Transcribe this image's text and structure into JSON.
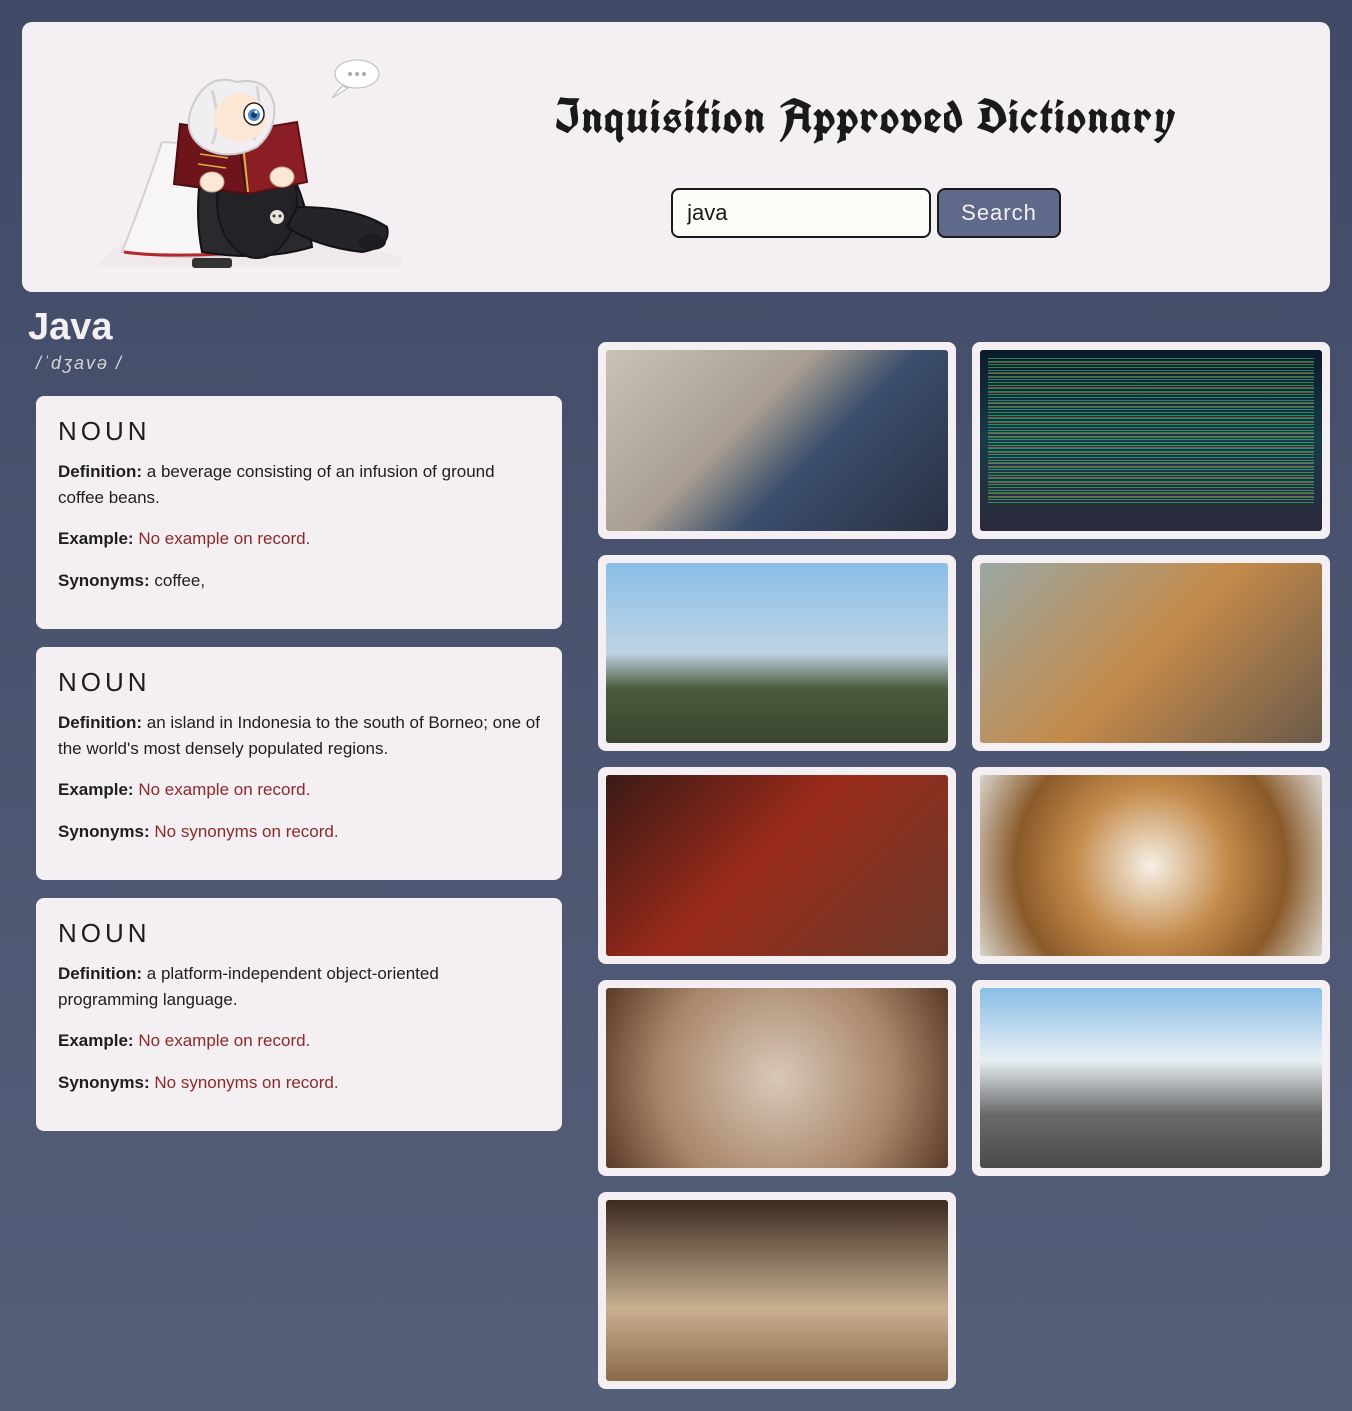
{
  "header": {
    "title": "Inquisition Approved Dictionary",
    "search_value": "java",
    "search_label": "Search"
  },
  "word": {
    "title": "Java",
    "phonetic": "/ˈdʒavə /"
  },
  "labels": {
    "definition": "Definition:",
    "example": "Example:",
    "synonyms": "Synonyms:",
    "no_example": "No example on record.",
    "no_synonyms": "No synonyms on record."
  },
  "definitions": [
    {
      "pos": "NOUN",
      "text": "a beverage consisting of an infusion of ground coffee beans.",
      "example": null,
      "synonyms": "coffee,"
    },
    {
      "pos": "NOUN",
      "text": "an island in Indonesia to the south of Borneo; one of the world's most densely populated regions.",
      "example": null,
      "synonyms": null
    },
    {
      "pos": "NOUN",
      "text": "a platform-independent object-oriented programming language.",
      "example": null,
      "synonyms": null
    }
  ],
  "images": [
    {
      "name": "laptop-with-java-books",
      "cls": "img-laptop-books"
    },
    {
      "name": "code-on-laptop-screen",
      "cls": "img-codescreen"
    },
    {
      "name": "prambanan-temple-java",
      "cls": "img-temple"
    },
    {
      "name": "volcano-landscape",
      "cls": "img-volcano"
    },
    {
      "name": "red-pour-over-coffee",
      "cls": "img-pourover"
    },
    {
      "name": "latte-art-cup",
      "cls": "img-latte"
    },
    {
      "name": "coffee-cup-topdown",
      "cls": "img-cup"
    },
    {
      "name": "borobudur-stupas",
      "cls": "img-borobudur"
    },
    {
      "name": "coffee-cup-partial",
      "cls": "img-peek"
    }
  ]
}
